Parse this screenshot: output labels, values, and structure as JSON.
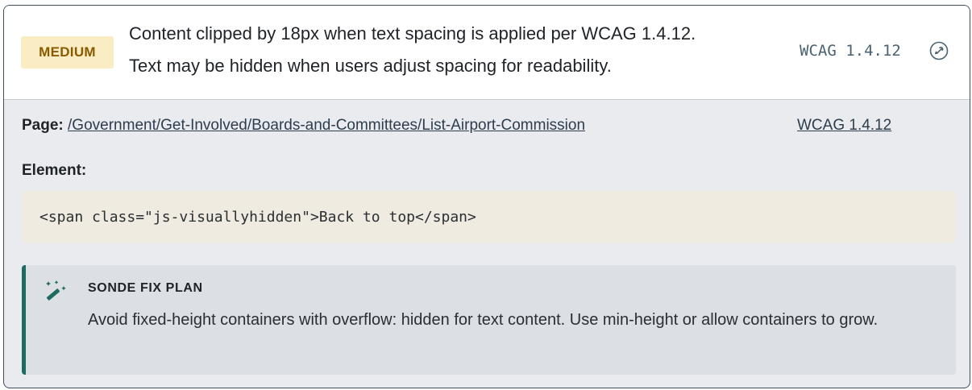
{
  "issue": {
    "severity": "MEDIUM",
    "title_line1": "Content clipped by 18px when text spacing is applied per WCAG 1.4.12.",
    "title_line2": "Text may be hidden when users adjust spacing for readability.",
    "wcag_code": "WCAG 1.4.12",
    "link_icon": "link-icon"
  },
  "details": {
    "page_label": "Page:",
    "page_url": "/Government/Get-Involved/Boards-and-Committees/List-Airport-Commission",
    "wcag_link": "WCAG 1.4.12",
    "element_label": "Element:",
    "element_code": "<span class=\"js-visuallyhidden\">Back to top</span>"
  },
  "fix_plan": {
    "icon": "magic-wand-icon",
    "title": "SONDE FIX PLAN",
    "body": "Avoid fixed-height containers with overflow: hidden for text content. Use min-height or allow containers to grow."
  },
  "colors": {
    "badge_bg": "#faecc3",
    "badge_text": "#8a5a00",
    "fix_accent": "#1f6b61",
    "code_bg": "#efebe0"
  }
}
